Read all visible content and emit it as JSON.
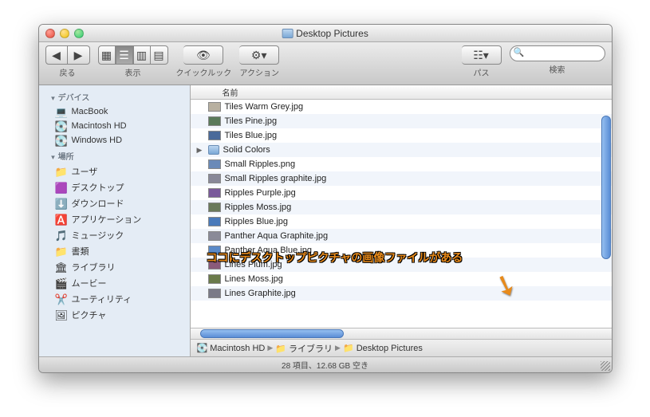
{
  "window": {
    "title": "Desktop Pictures"
  },
  "toolbar": {
    "back_label": "戻る",
    "view_label": "表示",
    "quicklook_label": "クイックルック",
    "action_label": "アクション",
    "path_label": "パス",
    "search_label": "検索",
    "search_placeholder": ""
  },
  "sidebar": {
    "devices_header": "デバイス",
    "devices": [
      {
        "icon": "💻",
        "label": "MacBook"
      },
      {
        "icon": "💽",
        "label": "Macintosh HD"
      },
      {
        "icon": "💽",
        "label": "Windows HD"
      }
    ],
    "places_header": "場所",
    "places": [
      {
        "icon": "📁",
        "label": "ユーザ"
      },
      {
        "icon": "🟪",
        "label": "デスクトップ"
      },
      {
        "icon": "⬇️",
        "label": "ダウンロード"
      },
      {
        "icon": "🅰️",
        "label": "アプリケーション"
      },
      {
        "icon": "🎵",
        "label": "ミュージック"
      },
      {
        "icon": "📁",
        "label": "書類"
      },
      {
        "icon": "🏛",
        "label": "ライブラリ"
      },
      {
        "icon": "🎬",
        "label": "ムービー"
      },
      {
        "icon": "✂️",
        "label": "ユーティリティ"
      },
      {
        "icon": "🖼",
        "label": "ピクチャ"
      }
    ]
  },
  "list": {
    "column_name": "名前",
    "items": [
      {
        "name": "Tiles Warm Grey.jpg",
        "thumb": "#b8b0a0",
        "folder": false
      },
      {
        "name": "Tiles Pine.jpg",
        "thumb": "#5a7a5a",
        "folder": false
      },
      {
        "name": "Tiles Blue.jpg",
        "thumb": "#4a6a9a",
        "folder": false
      },
      {
        "name": "Solid Colors",
        "thumb": "",
        "folder": true
      },
      {
        "name": "Small Ripples.png",
        "thumb": "#6a8ab8",
        "folder": false
      },
      {
        "name": "Small Ripples graphite.jpg",
        "thumb": "#888898",
        "folder": false
      },
      {
        "name": "Ripples Purple.jpg",
        "thumb": "#7a5a9a",
        "folder": false
      },
      {
        "name": "Ripples Moss.jpg",
        "thumb": "#6a7a5a",
        "folder": false
      },
      {
        "name": "Ripples Blue.jpg",
        "thumb": "#4a7aba",
        "folder": false
      },
      {
        "name": "Panther Aqua Graphite.jpg",
        "thumb": "#8a8a98",
        "folder": false
      },
      {
        "name": "Panther Aqua Blue.jpg",
        "thumb": "#5a8ac8",
        "folder": false
      },
      {
        "name": "Lines Plum.jpg",
        "thumb": "#8a5a7a",
        "folder": false
      },
      {
        "name": "Lines Moss.jpg",
        "thumb": "#6a7a4a",
        "folder": false
      },
      {
        "name": "Lines Graphite.jpg",
        "thumb": "#7a7a88",
        "folder": false
      }
    ]
  },
  "annotation": {
    "text": "ココにデスクトップピクチャの画像ファイルがある"
  },
  "pathbar": {
    "items": [
      {
        "icon": "💽",
        "label": "Macintosh HD"
      },
      {
        "icon": "📁",
        "label": "ライブラリ"
      },
      {
        "icon": "📁",
        "label": "Desktop Pictures"
      }
    ]
  },
  "status": {
    "text": "28 項目、12.68 GB 空き"
  }
}
